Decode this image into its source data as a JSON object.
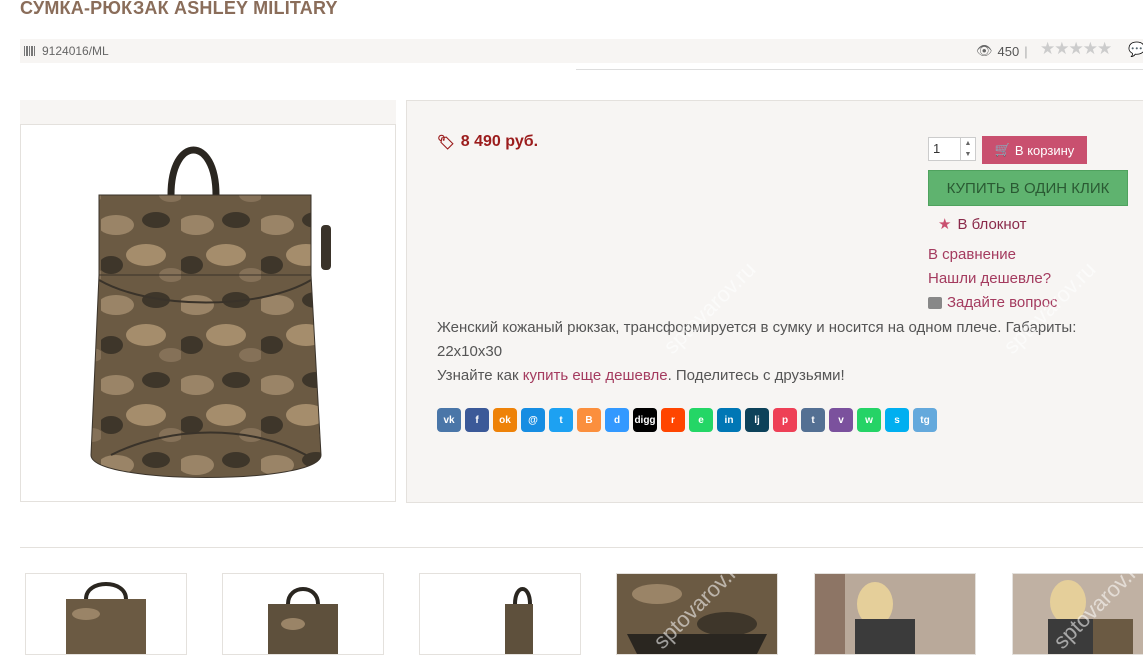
{
  "product": {
    "title": "СУМКА-РЮКЗАК ASHLEY MILITARY",
    "sku": "9124016/ML",
    "views": "450",
    "separator": "|"
  },
  "purchase": {
    "price": "8 490 руб.",
    "quantity": "1",
    "cart_label": "В корзину",
    "oneclick_label": "КУПИТЬ В ОДИН КЛИК",
    "notebook_label": "В блокнот",
    "compare_label": "В сравнение",
    "cheaper_label": "Нашли дешевле?",
    "ask_label": "Задайте вопрос"
  },
  "description": {
    "text": "Женский кожаный рюкзак, трансформируется в сумку и носится на одном плече. Габариты: 22x10x30",
    "share_prefix": "Узнайте как ",
    "share_link": "купить еще дешевле",
    "share_suffix": ". Поделитесь с друзьями!"
  },
  "share_buttons": [
    {
      "name": "vk",
      "label": "vk",
      "color": "#4a76a8"
    },
    {
      "name": "facebook",
      "label": "f",
      "color": "#3b5998"
    },
    {
      "name": "odnoklassniki",
      "label": "ok",
      "color": "#ee8208"
    },
    {
      "name": "moimir",
      "label": "@",
      "color": "#168de2"
    },
    {
      "name": "twitter",
      "label": "t",
      "color": "#1da1f2"
    },
    {
      "name": "blogger",
      "label": "B",
      "color": "#fb8f3d"
    },
    {
      "name": "delicious",
      "label": "d",
      "color": "#3399ff"
    },
    {
      "name": "digg",
      "label": "digg",
      "color": "#000000"
    },
    {
      "name": "reddit",
      "label": "r",
      "color": "#ff4500"
    },
    {
      "name": "evernote",
      "label": "e",
      "color": "#24d666"
    },
    {
      "name": "linkedin",
      "label": "in",
      "color": "#0077b5"
    },
    {
      "name": "livejournal",
      "label": "lj",
      "color": "#0d425a"
    },
    {
      "name": "pocket",
      "label": "p",
      "color": "#ee4056"
    },
    {
      "name": "tumblr",
      "label": "t",
      "color": "#547093"
    },
    {
      "name": "viber",
      "label": "v",
      "color": "#7b519d"
    },
    {
      "name": "whatsapp",
      "label": "w",
      "color": "#25d366"
    },
    {
      "name": "skype",
      "label": "s",
      "color": "#00aff0"
    },
    {
      "name": "telegram",
      "label": "tg",
      "color": "#64a9dc"
    }
  ],
  "watermark": "sptovarov.ru",
  "colors": {
    "accent": "#c9506f",
    "price": "#9b1c1c",
    "buy_green": "#5fb36f",
    "link": "#a43b5f"
  }
}
